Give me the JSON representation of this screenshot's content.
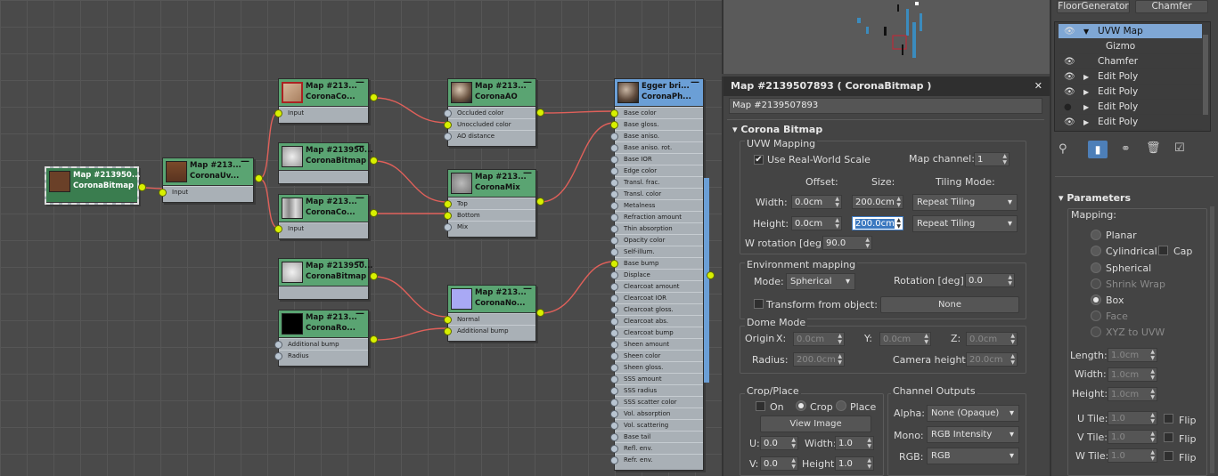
{
  "graph": {
    "nodes": {
      "bitmap_root": {
        "title": "Map #213950...",
        "subtitle": "CoronaBitmap"
      },
      "uvw": {
        "title": "Map #213...",
        "subtitle": "CoronaUv...",
        "rows": [
          "Input"
        ]
      },
      "col1_a": {
        "title": "Map #213...",
        "subtitle": "CoronaCo...",
        "rows": [
          "Input"
        ]
      },
      "col1_b": {
        "title": "Map #213950...",
        "subtitle": "CoronaBitmap"
      },
      "col1_c": {
        "title": "Map #213...",
        "subtitle": "CoronaCo...",
        "rows": [
          "Input"
        ]
      },
      "col1_d": {
        "title": "Map #213950...",
        "subtitle": "CoronaBitmap"
      },
      "col1_e": {
        "title": "Map #213...",
        "subtitle": "CoronaRo...",
        "rows": [
          "Additional bump",
          "Radius"
        ]
      },
      "ao": {
        "title": "Map #213...",
        "subtitle": "CoronaAO",
        "rows": [
          "Occluded color",
          "Unoccluded color",
          "AO distance"
        ]
      },
      "mix": {
        "title": "Map #213...",
        "subtitle": "CoronaMix",
        "rows": [
          "Top",
          "Bottom",
          "Mix"
        ]
      },
      "normal": {
        "title": "Map #213...",
        "subtitle": "CoronaNo...",
        "rows": [
          "Normal",
          "Additional bump"
        ]
      },
      "material": {
        "title": "Egger  bri...",
        "subtitle": "CoronaPh...",
        "rows": [
          "Base color",
          "Base gloss.",
          "Base aniso.",
          "Base aniso. rot.",
          "Base IOR",
          "Edge color",
          "Transl. frac.",
          "Transl. color",
          "Metalness",
          "Refraction amount",
          "Thin absorption",
          "Opacity color",
          "Self-illum.",
          "Base bump",
          "Displace",
          "Clearcoat amount",
          "Clearcoat IOR",
          "Clearcoat gloss.",
          "Clearcoat abs.",
          "Clearcoat bump",
          "Sheen amount",
          "Sheen color",
          "Sheen gloss.",
          "SSS amount",
          "SSS radius",
          "SSS scatter color",
          "Vol. absorption",
          "Vol. scattering",
          "Base tail",
          "Refl. env.",
          "Refr. env."
        ]
      }
    }
  },
  "material_panel": {
    "window_title": "Map #2139507893  ( CoronaBitmap )",
    "close": "✕",
    "name_field": "Map #2139507893",
    "rollout_title": "Corona Bitmap",
    "uvw": {
      "group_label": "UVW Mapping",
      "real_world_label": "Use Real-World Scale",
      "real_world_checked": "✔",
      "map_channel_label": "Map channel:",
      "map_channel": "1",
      "offset_header": "Offset:",
      "size_header": "Size:",
      "tiling_header": "Tiling Mode:",
      "width_label": "Width:",
      "height_label": "Height:",
      "width_offset": "0.0cm",
      "height_offset": "0.0cm",
      "width_size": "200.0cm",
      "height_size": "200.0cm",
      "width_tiling": "Repeat Tiling",
      "height_tiling": "Repeat Tiling",
      "w_rotation_label": "W rotation [deg]",
      "w_rotation": "90.0"
    },
    "env": {
      "group_label": "Environment mapping",
      "mode_label": "Mode:",
      "mode": "Spherical",
      "rotation_label": "Rotation [deg]:",
      "rotation": "0.0",
      "transform_label": "Transform from object:",
      "none_button": "None"
    },
    "dome": {
      "group_label": "Dome Mode",
      "origin_label": "Origin",
      "x_label": "X:",
      "x": "0.0cm",
      "y_label": "Y:",
      "y": "0.0cm",
      "z_label": "Z:",
      "z": "0.0cm",
      "radius_label": "Radius:",
      "radius": "200.0cm",
      "camera_height_label": "Camera height:",
      "camera_height": "20.0cm"
    },
    "crop": {
      "group_label": "Crop/Place",
      "on_label": "On",
      "crop_label": "Crop",
      "place_label": "Place",
      "view_image": "View Image",
      "u_label": "U:",
      "u": "0.0",
      "v_label": "V:",
      "v": "0.0",
      "width_label": "Width:",
      "width": "1.0",
      "height_label": "Height:",
      "height": "1.0"
    },
    "outputs": {
      "group_label": "Channel Outputs",
      "alpha_label": "Alpha:",
      "alpha": "None (Opaque)",
      "mono_label": "Mono:",
      "mono": "RGB Intensity",
      "rgb_label": "RGB:",
      "rgb": "RGB"
    }
  },
  "modifier_panel": {
    "top_buttons": [
      "FloorGenerator",
      "Chamfer"
    ],
    "stack": [
      {
        "label": "UVW Map",
        "selected": true
      },
      {
        "label": "Gizmo"
      },
      {
        "label": "Chamfer"
      },
      {
        "label": "Edit Poly"
      },
      {
        "label": "Edit Poly"
      },
      {
        "label": "Edit Poly"
      },
      {
        "label": "Edit Poly"
      }
    ],
    "parameters_title": "Parameters",
    "mapping_label": "Mapping:",
    "mapping_options": [
      "Planar",
      "Cylindrical",
      "Spherical",
      "Shrink Wrap",
      "Box",
      "Face",
      "XYZ to UVW"
    ],
    "cap_label": "Cap",
    "length_label": "Length:",
    "length": "1.0cm",
    "width_label": "Width:",
    "width": "1.0cm",
    "height_label": "Height:",
    "height": "1.0cm",
    "utile_label": "U Tile:",
    "utile": "1.0",
    "vtile_label": "V Tile:",
    "vtile": "1.0",
    "wtile_label": "W Tile:",
    "wtile": "1.0",
    "flip_label": "Flip"
  },
  "colors": {
    "node_header": "#5aa472",
    "material_header": "#6b9fd6",
    "wire": "#e0605a",
    "selection": "#7fa7d5"
  }
}
